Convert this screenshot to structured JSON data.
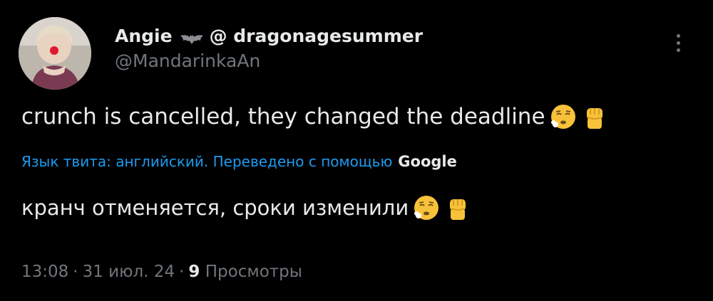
{
  "author": {
    "display_name_part1": "Angie",
    "display_name_icon": "bat-icon",
    "display_name_part2": "@ dragonagesummer",
    "handle": "@MandarinkaAn"
  },
  "tweet": {
    "text": "crunch is cancelled, they changed the deadline",
    "emojis": [
      "exhausted-face-emoji",
      "raised-fist-emoji"
    ]
  },
  "translation": {
    "notice": "Язык твита: английский. Переведено с помощью",
    "provider": "Google",
    "text": "кранч отменяется, сроки изменили"
  },
  "meta": {
    "time": "13:08",
    "date": "31 июл. 24",
    "views_count": "9",
    "views_label": "Просмотры",
    "separator": "·"
  },
  "colors": {
    "background": "#000000",
    "primary_text": "#e7e9ea",
    "secondary_text": "#71767b",
    "link": "#1d9bf0"
  }
}
